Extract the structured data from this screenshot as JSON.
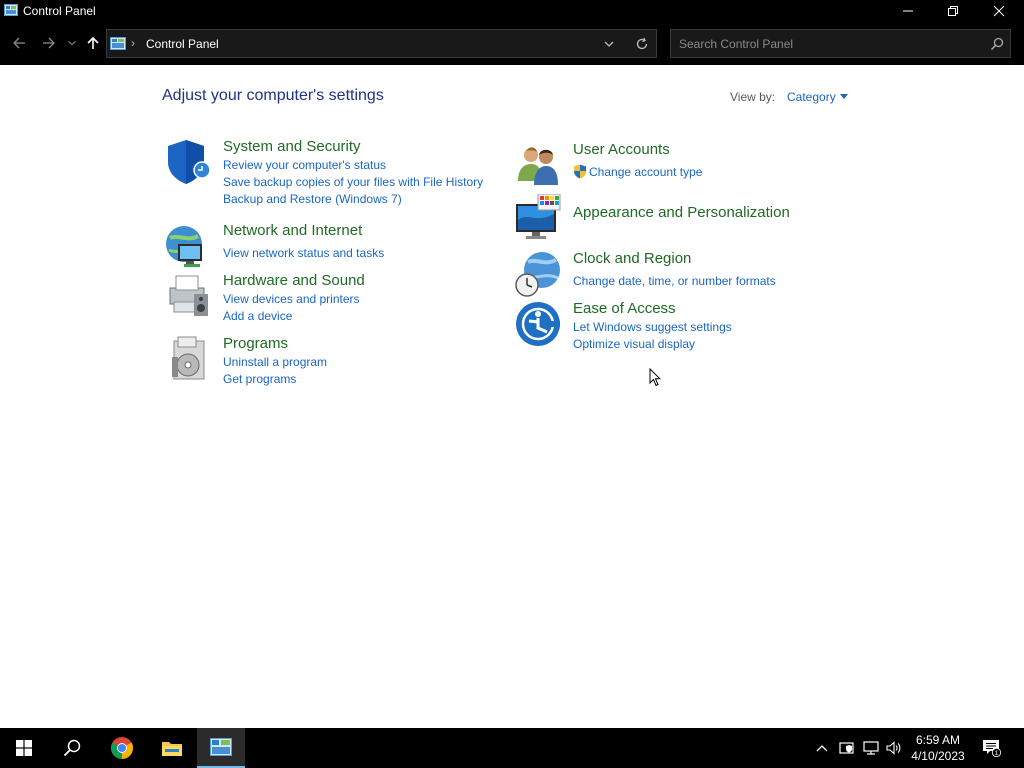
{
  "window": {
    "title": "Control Panel"
  },
  "address": {
    "breadcrumb": "Control Panel",
    "separator": "›",
    "search_placeholder": "Search Control Panel"
  },
  "content": {
    "heading": "Adjust your computer's settings",
    "view_by_label": "View by:",
    "view_by_value": "Category",
    "categories": [
      {
        "title": "System and Security",
        "icon": "shield-icon",
        "links": [
          "Review your computer's status",
          "Save backup copies of your files with File History",
          "Backup and Restore (Windows 7)"
        ]
      },
      {
        "title": "Network and Internet",
        "icon": "network-globe-icon",
        "links": [
          "View network status and tasks"
        ]
      },
      {
        "title": "Hardware and Sound",
        "icon": "printer-speaker-icon",
        "links": [
          "View devices and printers",
          "Add a device"
        ]
      },
      {
        "title": "Programs",
        "icon": "programs-disc-icon",
        "links": [
          "Uninstall a program",
          "Get programs"
        ]
      },
      {
        "title": "User Accounts",
        "icon": "users-icon",
        "links": [
          "Change account type"
        ]
      },
      {
        "title": "Appearance and Personalization",
        "icon": "monitor-palette-icon",
        "links": []
      },
      {
        "title": "Clock and Region",
        "icon": "clock-globe-icon",
        "links": [
          "Change date, time, or number formats"
        ]
      },
      {
        "title": "Ease of Access",
        "icon": "ease-of-access-icon",
        "links": [
          "Let Windows suggest settings",
          "Optimize visual display"
        ]
      }
    ]
  },
  "taskbar": {
    "apps": [
      "windows-start-icon",
      "search-icon",
      "chrome-icon",
      "file-explorer-icon",
      "control-panel-icon"
    ],
    "time": "6:59 AM",
    "date": "4/10/2023",
    "notification_count": "1"
  },
  "colors": {
    "heading": "#1e3287",
    "category_title": "#1f6b23",
    "link": "#1a66c7",
    "chrome_dark": "#000000"
  }
}
